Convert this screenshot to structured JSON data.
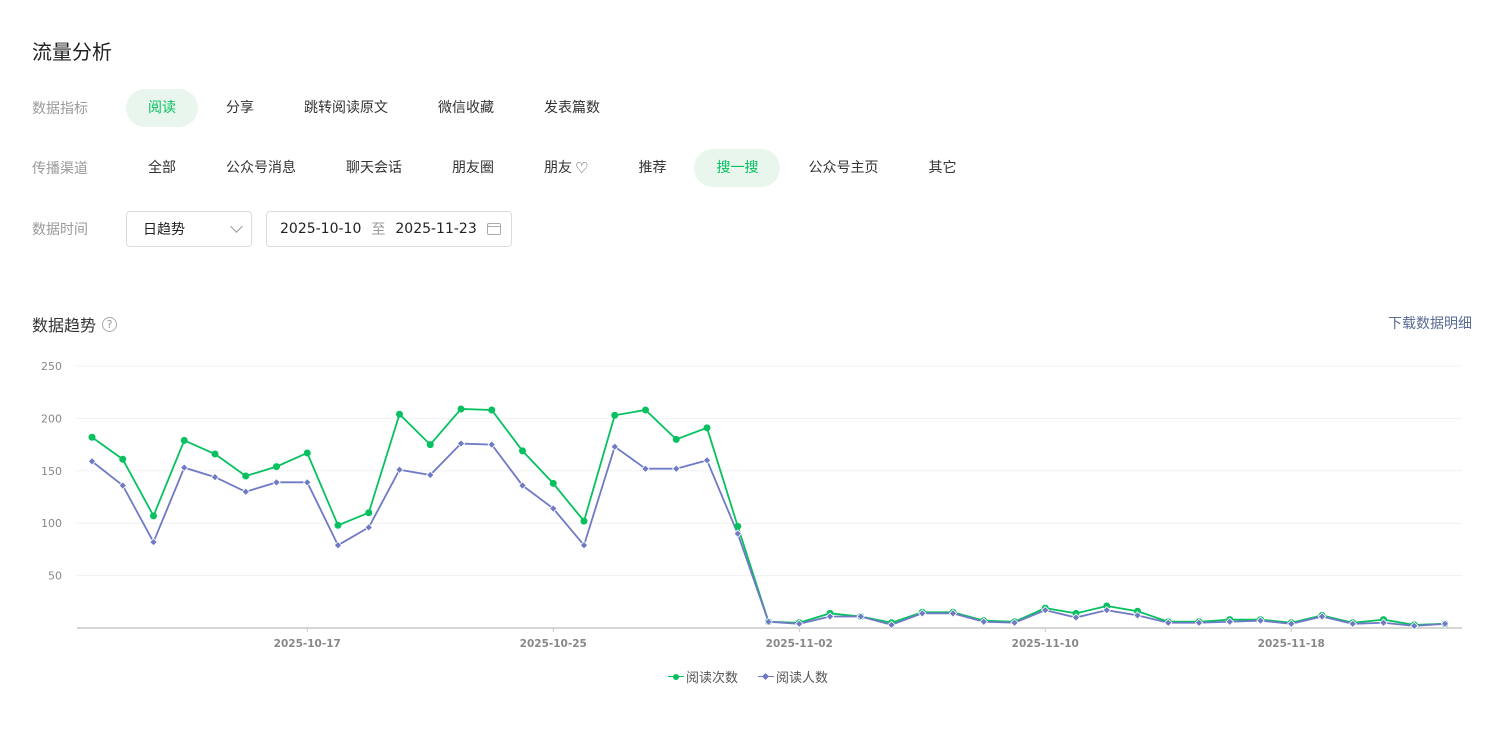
{
  "page": {
    "title": "流量分析"
  },
  "metrics": {
    "label": "数据指标",
    "items": [
      "阅读",
      "分享",
      "跳转阅读原文",
      "微信收藏",
      "发表篇数"
    ],
    "active": 0
  },
  "channels": {
    "label": "传播渠道",
    "items": [
      "全部",
      "公众号消息",
      "聊天会话",
      "朋友圈",
      "朋友",
      "推荐",
      "搜一搜",
      "公众号主页",
      "其它"
    ],
    "active": 6
  },
  "time": {
    "label": "数据时间",
    "granularity": "日趋势",
    "start": "2025-10-10",
    "to": "至",
    "end": "2025-11-23"
  },
  "trend": {
    "title": "数据趋势",
    "help": "?",
    "download": "下载数据明细"
  },
  "colors": {
    "accent": "#07c160",
    "series1": "#07c160",
    "series2": "#6e7ac5",
    "link": "#576b95"
  },
  "chart_data": {
    "type": "line",
    "x_ticks": [
      "2025-10-17",
      "2025-10-25",
      "2025-11-02",
      "2025-11-10",
      "2025-11-18"
    ],
    "x_tick_index": [
      7,
      15,
      23,
      31,
      39
    ],
    "y_ticks": [
      50,
      100,
      150,
      200,
      250
    ],
    "ylim": [
      0,
      250
    ],
    "x": [
      "2025-10-10",
      "2025-10-11",
      "2025-10-12",
      "2025-10-13",
      "2025-10-14",
      "2025-10-15",
      "2025-10-16",
      "2025-10-17",
      "2025-10-18",
      "2025-10-19",
      "2025-10-20",
      "2025-10-21",
      "2025-10-22",
      "2025-10-23",
      "2025-10-24",
      "2025-10-25",
      "2025-10-26",
      "2025-10-27",
      "2025-10-28",
      "2025-10-29",
      "2025-10-30",
      "2025-10-31",
      "2025-11-01",
      "2025-11-02",
      "2025-11-03",
      "2025-11-04",
      "2025-11-05",
      "2025-11-06",
      "2025-11-07",
      "2025-11-08",
      "2025-11-09",
      "2025-11-10",
      "2025-11-11",
      "2025-11-12",
      "2025-11-13",
      "2025-11-14",
      "2025-11-15",
      "2025-11-16",
      "2025-11-17",
      "2025-11-18",
      "2025-11-19",
      "2025-11-20",
      "2025-11-21",
      "2025-11-22",
      "2025-11-23"
    ],
    "legend_position": "bottom-center",
    "series": [
      {
        "name": "阅读次数",
        "marker": "circle",
        "values": [
          182,
          161,
          107,
          179,
          166,
          145,
          154,
          167,
          98,
          110,
          204,
          175,
          209,
          208,
          169,
          138,
          102,
          203,
          208,
          180,
          191,
          97,
          6,
          5,
          14,
          11,
          5,
          15,
          15,
          7,
          6,
          19,
          14,
          21,
          16,
          6,
          6,
          8,
          8,
          5,
          12,
          5,
          8,
          3,
          4
        ]
      },
      {
        "name": "阅读人数",
        "marker": "diamond",
        "values": [
          159,
          136,
          82,
          153,
          144,
          130,
          139,
          139,
          79,
          96,
          151,
          146,
          176,
          175,
          136,
          114,
          79,
          173,
          152,
          152,
          160,
          90,
          6,
          4,
          11,
          11,
          3,
          14,
          14,
          6,
          5,
          17,
          10,
          17,
          12,
          5,
          5,
          6,
          7,
          4,
          11,
          4,
          5,
          2,
          4
        ]
      }
    ]
  }
}
